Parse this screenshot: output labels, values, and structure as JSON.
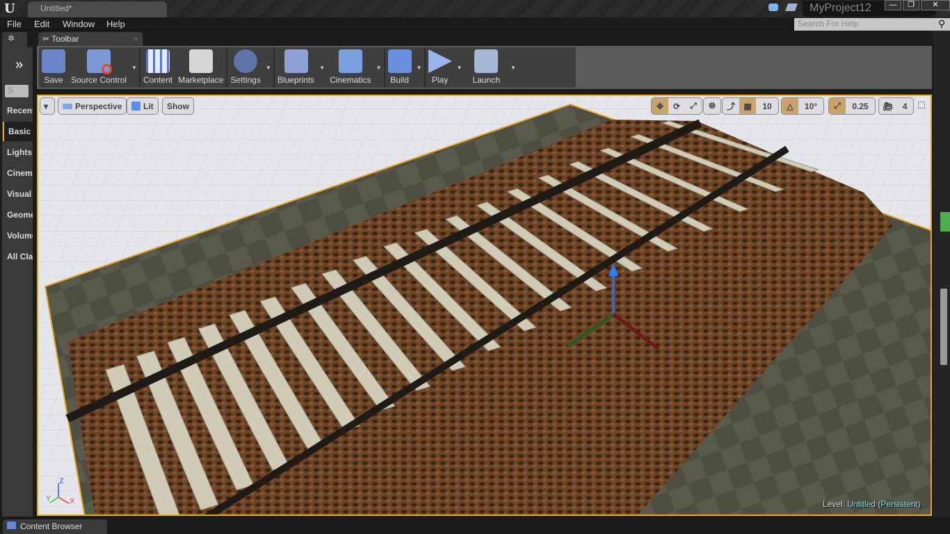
{
  "window": {
    "tab_title": "Untitled*",
    "project_name": "MyProject12",
    "minimize": "—",
    "restore": "❐",
    "close": "✕"
  },
  "menu": [
    "File",
    "Edit",
    "Window",
    "Help"
  ],
  "help_search": {
    "placeholder": "Search For Help"
  },
  "panels": {
    "toolbar_tab": "Toolbar",
    "content_browser_tab": "Content Browser"
  },
  "toolbar": {
    "buttons": [
      {
        "label": "Save",
        "icon": "save-icon",
        "color": "#6b86c9"
      },
      {
        "label": "Source Control",
        "icon": "source-control-icon",
        "color": "#7d9ad6"
      },
      {
        "label": "Content",
        "icon": "content-icon",
        "color": "#5a78c8"
      },
      {
        "label": "Marketplace",
        "icon": "marketplace-icon",
        "color": "#d8d8d8"
      },
      {
        "label": "Settings",
        "icon": "settings-icon",
        "color": "#5e74a8"
      },
      {
        "label": "Blueprints",
        "icon": "blueprints-icon",
        "color": "#8ea2d8"
      },
      {
        "label": "Cinematics",
        "icon": "cinematics-icon",
        "color": "#7aa0e0"
      },
      {
        "label": "Build",
        "icon": "build-icon",
        "color": "#6a8ee0"
      },
      {
        "label": "Play",
        "icon": "play-icon",
        "color": "#9bb4ec"
      },
      {
        "label": "Launch",
        "icon": "launch-icon",
        "color": "#a6b8d8"
      }
    ]
  },
  "place_modes": {
    "search_placeholder": "S",
    "categories": [
      "Recent",
      "Basic",
      "Lights",
      "Cinematic",
      "Visual",
      "Geometry",
      "Volumes",
      "All Classes"
    ],
    "selected": "Basic"
  },
  "viewport": {
    "view_mode": "Perspective",
    "lighting": "Lit",
    "show": "Show",
    "grid_snap": "10",
    "rotation_snap": "10°",
    "scale_snap": "0.25",
    "camera_speed": "4",
    "level_label": "Level:",
    "level_name": "Untitled (Persistent)",
    "axes": {
      "x": "X",
      "y": "Y",
      "z": "Z"
    }
  },
  "colors": {
    "accent": "#e8a624",
    "level_name": "#8fe4e9"
  }
}
